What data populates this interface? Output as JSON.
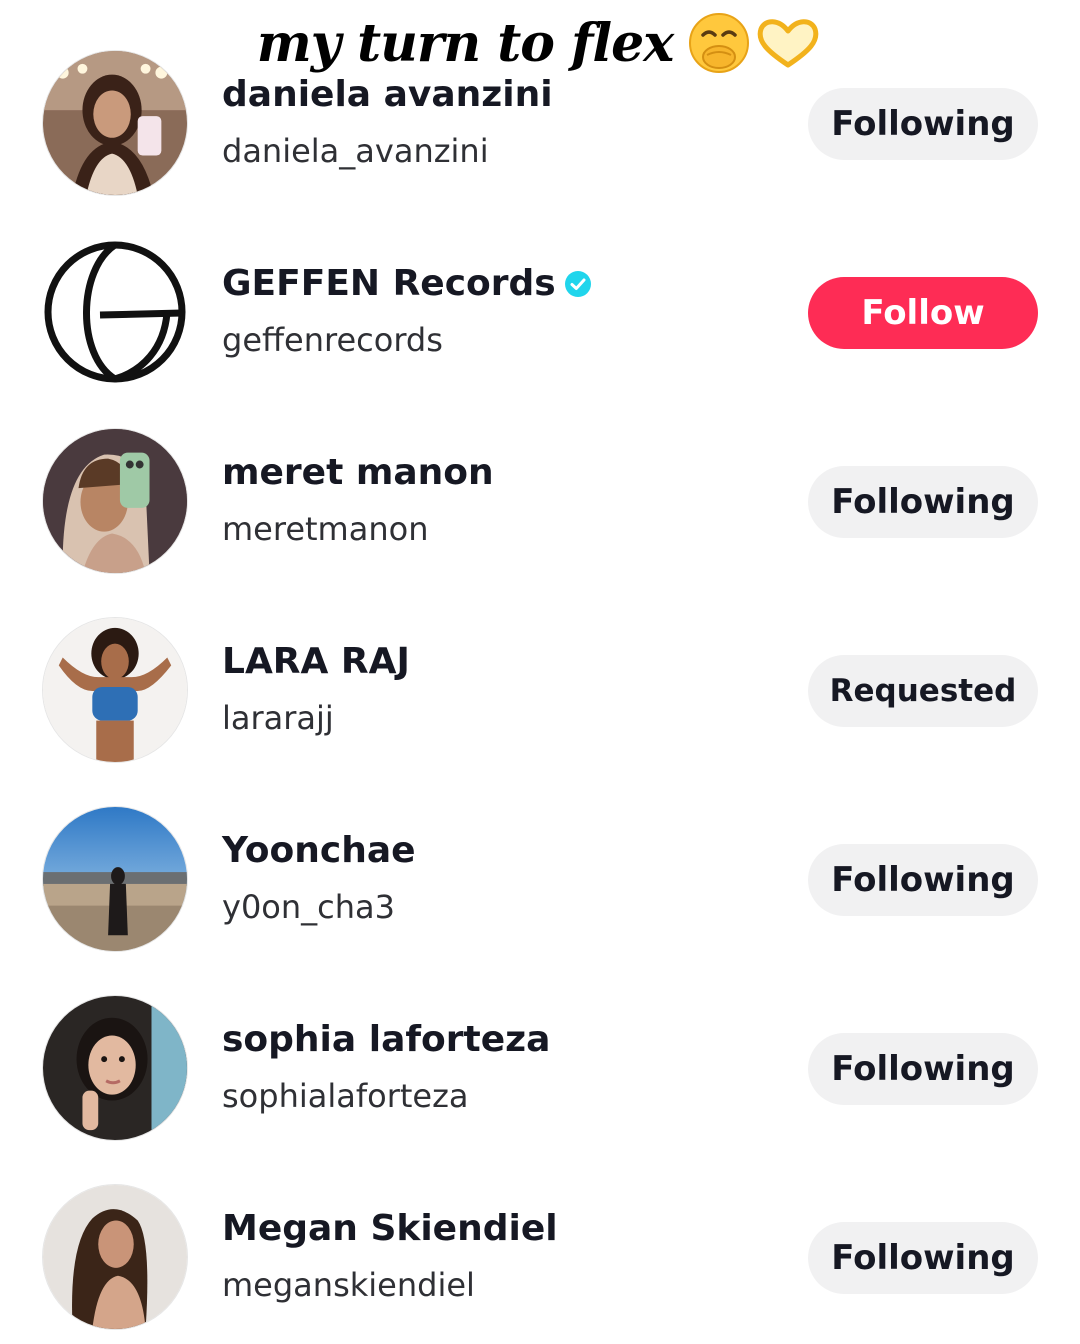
{
  "caption": {
    "text": "my turn to flex",
    "emojis": [
      "face-with-hand-over-mouth-emoji",
      "heart-hands-emoji"
    ]
  },
  "colors": {
    "follow_button": "#fe2c55",
    "following_button": "#f1f1f2",
    "verified_badge": "#20d5ec"
  },
  "accounts": [
    {
      "name": "daniela avanzini",
      "handle": "daniela_avanzini",
      "button": "Following",
      "verified": false,
      "avatar": "selfie-mirror-photo"
    },
    {
      "name": "GEFFEN Records",
      "handle": "geffenrecords",
      "button": "Follow",
      "verified": true,
      "avatar": "geffen-g-logo"
    },
    {
      "name": "meret manon",
      "handle": "meretmanon",
      "button": "Following",
      "verified": false,
      "avatar": "selfie-phone-photo"
    },
    {
      "name": "LARA RAJ",
      "handle": "lararajj",
      "button": "Requested",
      "verified": false,
      "avatar": "portrait-photo"
    },
    {
      "name": "Yoonchae",
      "handle": "y0on_cha3",
      "button": "Following",
      "verified": false,
      "avatar": "beach-landscape-photo"
    },
    {
      "name": "sophia laforteza",
      "handle": "sophialaforteza",
      "button": "Following",
      "verified": false,
      "avatar": "closeup-portrait-photo"
    },
    {
      "name": "Megan Skiendiel",
      "handle": "meganskiendiel",
      "button": "Following",
      "verified": false,
      "avatar": "portrait-photo"
    }
  ]
}
